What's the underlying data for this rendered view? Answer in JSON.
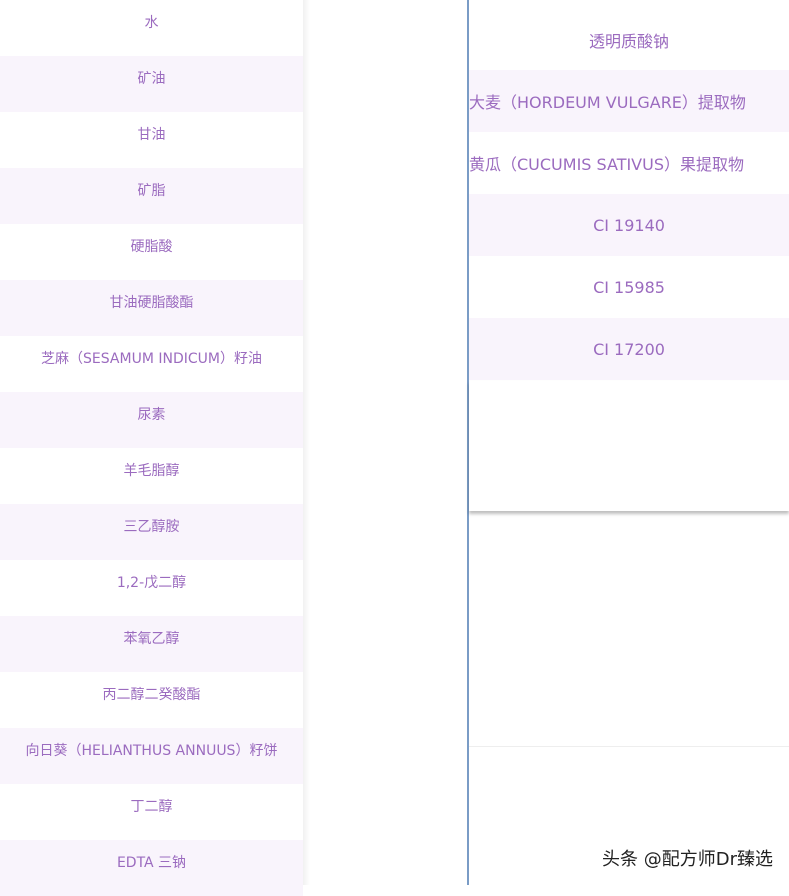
{
  "left_list": {
    "items": [
      "水",
      "矿油",
      "甘油",
      "矿脂",
      "硬脂酸",
      "甘油硬脂酸酯",
      "芝麻（SESAMUM INDICUM）籽油",
      "尿素",
      "羊毛脂醇",
      "三乙醇胺",
      "1,2-戊二醇",
      "苯氧乙醇",
      "丙二醇二癸酸酯",
      "向日葵（HELIANTHUS ANNUUS）籽饼",
      "丁二醇",
      "EDTA 三钠"
    ]
  },
  "right_list": {
    "items": [
      "透明质酸钠",
      "大麦（HORDEUM VULGARE）提取物",
      "黄瓜（CUCUMIS SATIVUS）果提取物",
      "CI 19140",
      "CI 15985",
      "CI 17200"
    ]
  },
  "watermark": {
    "text": "头条 @配方师Dr臻选"
  },
  "colors": {
    "text": "#9b6bbf",
    "stripe": "#f9f4fc",
    "divider": "#7a9cc6"
  }
}
